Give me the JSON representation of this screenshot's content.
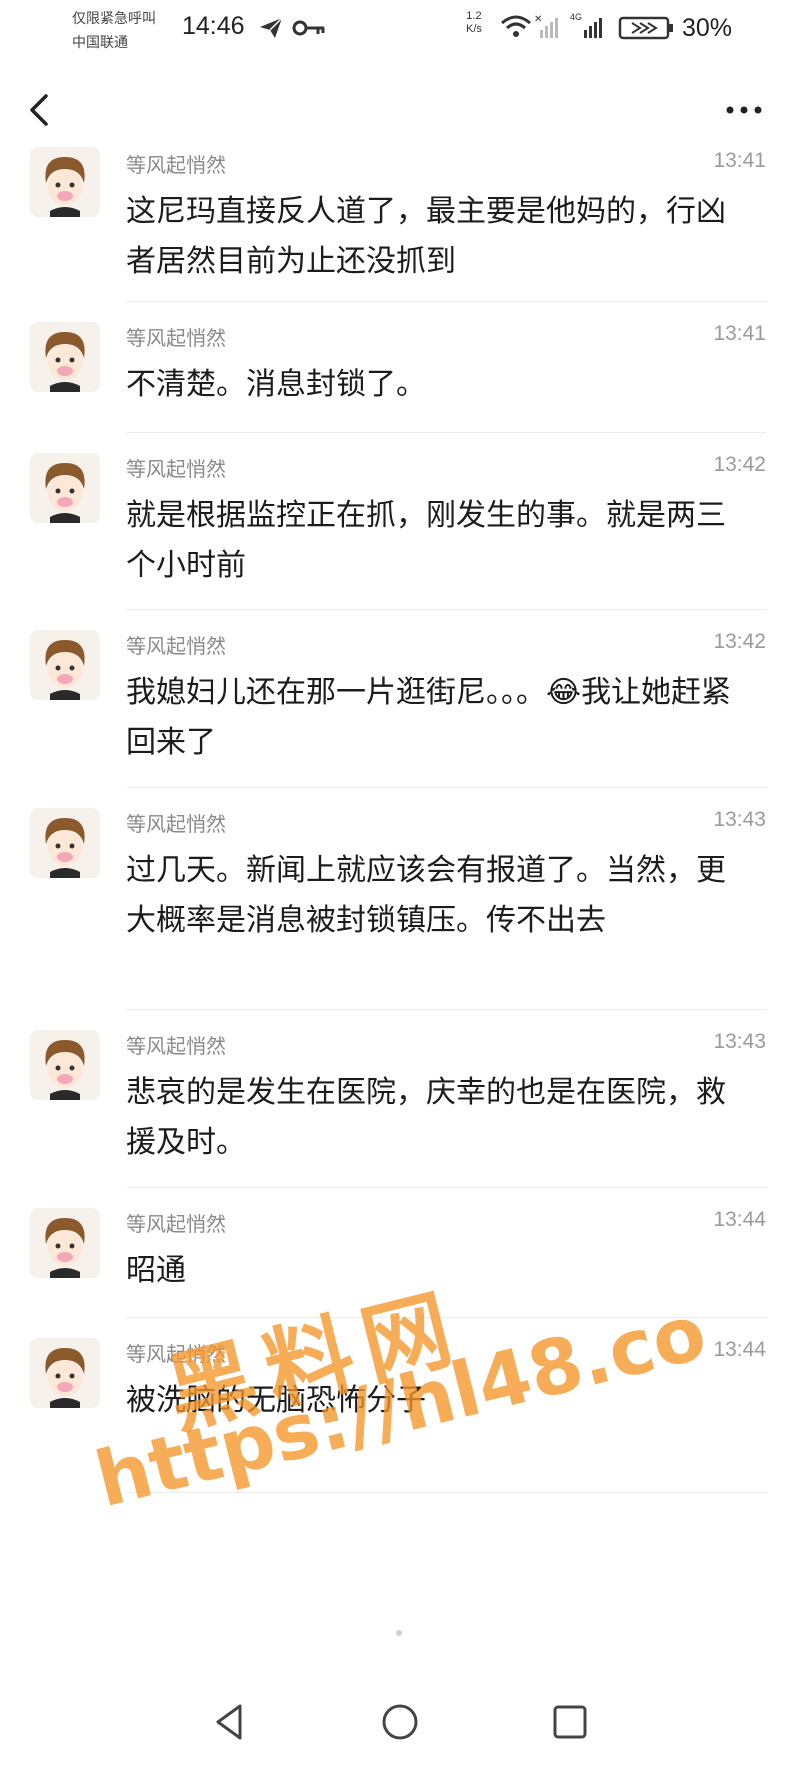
{
  "status_bar": {
    "carrier_line1": "仅限紧急呼叫",
    "carrier_line2": "中国联通",
    "time": "14:46",
    "net_speed_value": "1.2",
    "net_speed_unit": "K/s",
    "signal_label": "4G",
    "battery": "30%"
  },
  "nav": {
    "back_icon": "chevron-left-icon",
    "more_icon": "more-dots-icon"
  },
  "comments": [
    {
      "user": "等风起悄然",
      "time": "13:41",
      "text": "这尼玛直接反人道了，最主要是他妈的，行凶者居然目前为止还没抓到"
    },
    {
      "user": "等风起悄然",
      "time": "13:41",
      "text": "不清楚。消息封锁了。"
    },
    {
      "user": "等风起悄然",
      "time": "13:42",
      "text": "就是根据监控正在抓，刚发生的事。就是两三个小时前"
    },
    {
      "user": "等风起悄然",
      "time": "13:42",
      "text_before": "我媳妇儿还在那一片逛街尼。。。",
      "emoji": "😂",
      "text_after": "我让她赶紧回来了"
    },
    {
      "user": "等风起悄然",
      "time": "13:43",
      "text": "过几天。新闻上就应该会有报道了。当然，更大概率是消息被封锁镇压。传不出去"
    },
    {
      "user": "等风起悄然",
      "time": "13:43",
      "text": "悲哀的是发生在医院，庆幸的也是在医院，救援及时。"
    },
    {
      "user": "等风起悄然",
      "time": "13:44",
      "text": "昭通"
    },
    {
      "user": "等风起悄然",
      "time": "13:44",
      "text": "被洗脑的无脑恐怖分子"
    }
  ],
  "watermark": {
    "line1": "黑料网",
    "line2": "https://hl48.co"
  },
  "colors": {
    "watermark": "#f59628",
    "username": "#8a8a8a",
    "time": "#9a9a9a"
  }
}
